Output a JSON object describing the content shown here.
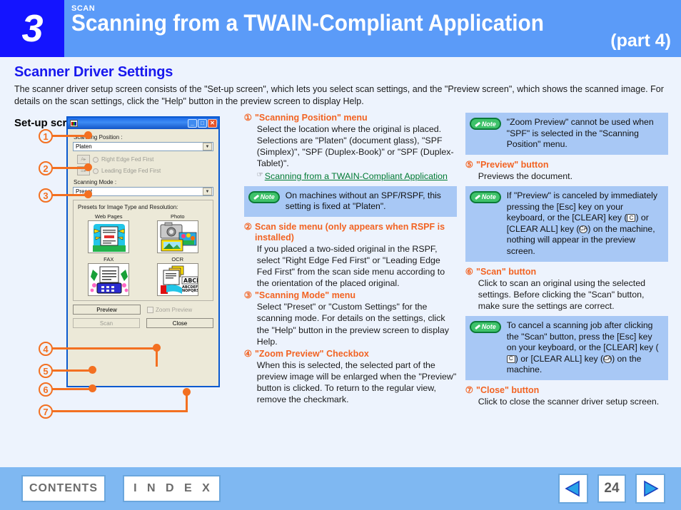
{
  "header": {
    "chapter_number": "3",
    "kicker": "SCAN",
    "title": "Scanning from a TWAIN-Compliant Application",
    "part": "(part 4)"
  },
  "section": {
    "title": "Scanner Driver Settings",
    "intro": "The scanner driver setup screen consists of the \"Set-up screen\", which lets you select scan settings, and the \"Preview screen\", which shows the scanned image. For details on the scan settings, click the \"Help\" button in the preview screen to display Help.",
    "subhead": "Set-up screen"
  },
  "callouts": [
    "1",
    "2",
    "3",
    "4",
    "5",
    "6",
    "7"
  ],
  "dialog": {
    "title": "",
    "window_buttons": [
      "minimize",
      "maximize",
      "close"
    ],
    "scanning_position_label": "Scanning Position :",
    "scanning_position_value": "Platen",
    "scan_side_options": [
      "Right Edge Fed First",
      "Leading Edge Fed First"
    ],
    "scanning_mode_label": "Scanning Mode :",
    "scanning_mode_value": "Preset",
    "presets_label": "Presets for Image Type and Resolution:",
    "presets": [
      "Web Pages",
      "Photo",
      "FAX",
      "OCR"
    ],
    "preview_button": "Preview",
    "scan_button": "Scan",
    "zoom_preview_checkbox": "Zoom Preview",
    "close_button": "Close"
  },
  "middle_column": {
    "items": [
      {
        "num": "①",
        "head": "\"Scanning Position\" menu",
        "body": "Select the location where the original is placed. Selections are \"Platen\" (document glass), \"SPF (Simplex)\", \"SPF (Duplex-Book)\" or \"SPF (Duplex-Tablet)\".",
        "link": "Scanning from a TWAIN-Compliant Application"
      },
      {
        "num": "②",
        "head": "Scan side menu (only appears when RSPF is installed)",
        "body": "If you placed a two-sided original in the RSPF, select \"Right Edge Fed First\" or \"Leading Edge Fed First\" from the scan side menu according to the orientation of the placed original."
      },
      {
        "num": "③",
        "head": "\"Scanning Mode\" menu",
        "body": "Select \"Preset\" or \"Custom Settings\" for the scanning mode. For details on the settings, click the \"Help\" button in the preview screen to display Help."
      },
      {
        "num": "④",
        "head": "\"Zoom Preview\" Checkbox",
        "body": "When this is selected, the selected part of the preview image will be enlarged when the \"Preview\" button is clicked. To return to the regular view, remove the checkmark."
      }
    ],
    "note1": {
      "label": "Note",
      "text": "On machines without an SPF/RSPF, this setting is fixed at \"Platen\"."
    }
  },
  "right_column": {
    "note1": {
      "label": "Note",
      "text": "\"Zoom Preview\" cannot be used when \"SPF\" is selected in the \"Scanning Position\" menu."
    },
    "item5": {
      "num": "⑤",
      "head": "\"Preview\" button",
      "body": "Previews the document."
    },
    "note2": {
      "label": "Note",
      "text_a": "If \"Preview\" is canceled by immediately pressing the [Esc] key on your keyboard, or the [CLEAR] key (",
      "key_clear": "C",
      "text_b": ") or [CLEAR ALL] key (",
      "key_clear_all": "CA",
      "text_c": ") on the machine, nothing will appear in the preview screen."
    },
    "item6": {
      "num": "⑥",
      "head": "\"Scan\" button",
      "body": "Click to scan an original using the selected settings. Before clicking the \"Scan\" button, make sure the settings are correct."
    },
    "note3": {
      "label": "Note",
      "text_a": "To cancel a scanning job after clicking the \"Scan\" button, press the [Esc] key on your keyboard, or the [CLEAR] key (",
      "key_clear": "C",
      "text_b": ") or [CLEAR ALL] key (",
      "key_clear_all": "CA",
      "text_c": ") on the machine."
    },
    "item7": {
      "num": "⑦",
      "head": "\"Close\" button",
      "body": "Click to close the scanner driver setup screen."
    }
  },
  "footer": {
    "contents": "CONTENTS",
    "index": "I N D E X",
    "page": "24",
    "prev_icon": "left-triangle-icon",
    "next_icon": "right-triangle-icon"
  },
  "colors": {
    "page_bg": "#edf3fd",
    "header_bg": "#5b9bf8",
    "chapter_bg": "#1414ff",
    "accent_orange": "#f26322",
    "heading_blue": "#1818ee",
    "note_bg": "#a8c8f5",
    "note_green": "#0b7a37",
    "link_green": "#007a33",
    "footer_bg": "#7fb8f2"
  }
}
